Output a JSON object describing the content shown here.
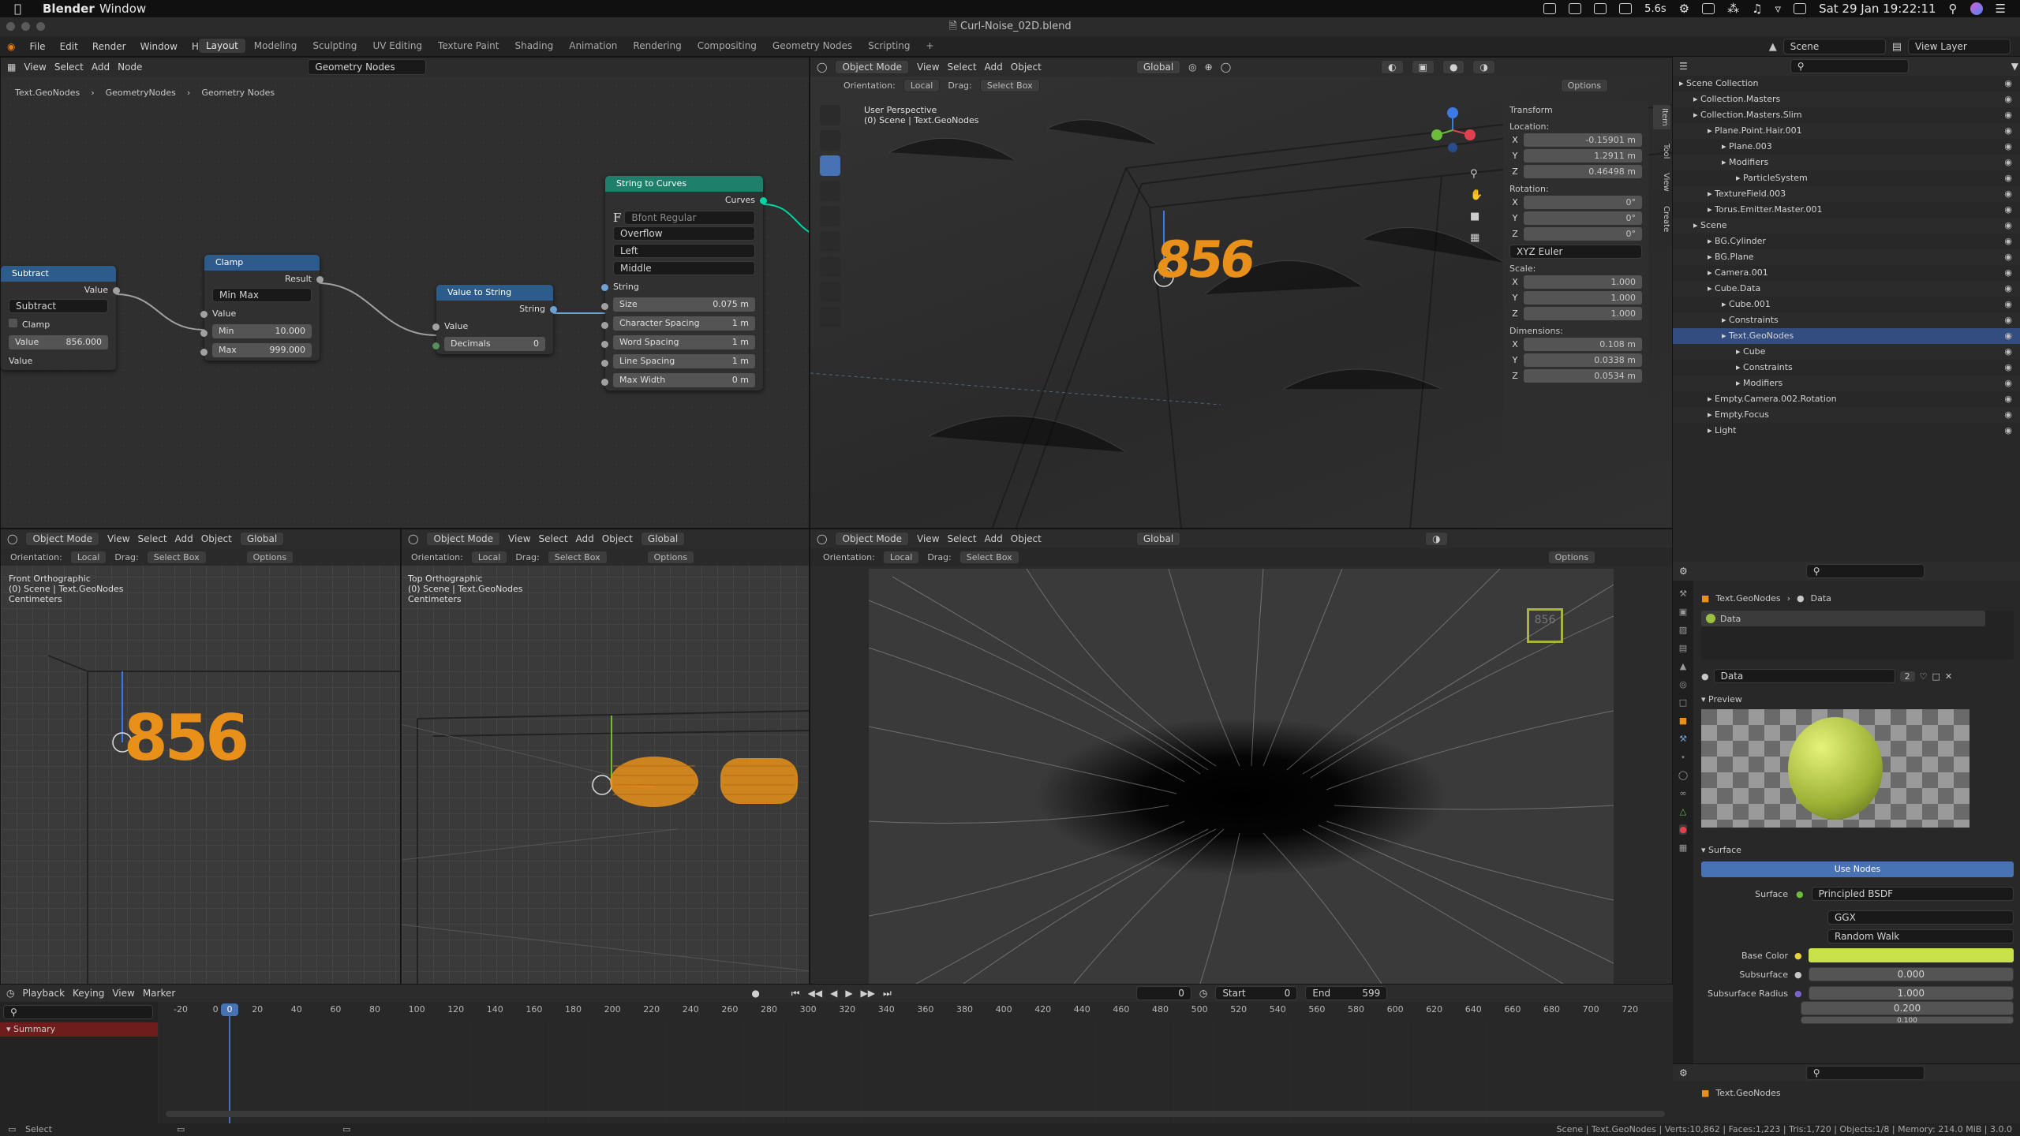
{
  "macbar": {
    "app": "Blender",
    "menu": "Window",
    "battery": "5.6s",
    "datetime": "Sat 29 Jan  19:22:11"
  },
  "window": {
    "title": "Curl-Noise_02D.blend"
  },
  "topmenu": [
    "File",
    "Edit",
    "Render",
    "Window",
    "Help"
  ],
  "workspaces": [
    "Layout",
    "Modeling",
    "Sculpting",
    "UV Editing",
    "Texture Paint",
    "Shading",
    "Animation",
    "Rendering",
    "Compositing",
    "Geometry Nodes",
    "Scripting",
    "+"
  ],
  "scene": "Scene",
  "view_layer": "View Layer",
  "nodeeditor": {
    "menus": [
      "View",
      "Select",
      "Add",
      "Node"
    ],
    "tree": "Geometry Nodes",
    "breadcrumb": [
      "Text.GeoNodes",
      "GeometryNodes",
      "Geometry Nodes"
    ],
    "subtract": {
      "title": "Subtract",
      "op": "Subtract",
      "clamp": "Clamp",
      "value_label": "Value",
      "value": "856.000",
      "out": "Value",
      "in": "Value"
    },
    "clamp": {
      "title": "Clamp",
      "result": "Result",
      "mode": "Min Max",
      "value": "Value",
      "min_label": "Min",
      "min": "10.000",
      "max_label": "Max",
      "max": "999.000"
    },
    "v2s": {
      "title": "Value to String",
      "string": "String",
      "value": "Value",
      "decimals_label": "Decimals",
      "decimals": "0"
    },
    "s2c": {
      "title": "String to Curves",
      "curves": "Curves",
      "font": "Bfont Regular",
      "overflow": "Overflow",
      "align_x": "Left",
      "align_y": "Middle",
      "string": "String",
      "size_label": "Size",
      "size": "0.075 m",
      "cs_label": "Character Spacing",
      "cs": "1 m",
      "ws_label": "Word Spacing",
      "ws": "1 m",
      "ls_label": "Line Spacing",
      "ls": "1 m",
      "mw_label": "Max Width",
      "mw": "0 m"
    }
  },
  "vp_main": {
    "mode": "Object Mode",
    "menus": [
      "View",
      "Select",
      "Add",
      "Object"
    ],
    "transform": "Global",
    "orientation_label": "Orientation:",
    "orientation": "Local",
    "drag_label": "Drag:",
    "drag": "Select Box",
    "options": "Options",
    "title": "User Perspective",
    "subtitle": "(0) Scene | Text.GeoNodes",
    "digits": "856"
  },
  "npanel": {
    "title": "Transform",
    "location": "Location:",
    "loc": [
      "-0.15901 m",
      "1.2911 m",
      "0.46498 m"
    ],
    "rotation": "Rotation:",
    "rot": [
      "0°",
      "0°",
      "0°"
    ],
    "euler": "XYZ Euler",
    "scale": "Scale:",
    "scl": [
      "1.000",
      "1.000",
      "1.000"
    ],
    "dimensions": "Dimensions:",
    "dim": [
      "0.108 m",
      "0.0338 m",
      "0.0534 m"
    ],
    "axes": [
      "X",
      "Y",
      "Z"
    ],
    "tabs": [
      "Item",
      "Tool",
      "View",
      "Create"
    ]
  },
  "outliner": {
    "rows": [
      {
        "t": "Scene Collection",
        "d": 0
      },
      {
        "t": "Collection.Masters",
        "d": 1
      },
      {
        "t": "Collection.Masters.Slim",
        "d": 1
      },
      {
        "t": "Plane.Point.Hair.001",
        "d": 2
      },
      {
        "t": "Plane.003",
        "d": 3
      },
      {
        "t": "Modifiers",
        "d": 3
      },
      {
        "t": "ParticleSystem",
        "d": 4
      },
      {
        "t": "TextureField.003",
        "d": 2
      },
      {
        "t": "Torus.Emitter.Master.001",
        "d": 2
      },
      {
        "t": "Scene",
        "d": 1
      },
      {
        "t": "BG.Cylinder",
        "d": 2
      },
      {
        "t": "BG.Plane",
        "d": 2
      },
      {
        "t": "Camera.001",
        "d": 2
      },
      {
        "t": "Cube.Data",
        "d": 2
      },
      {
        "t": "Cube.001",
        "d": 3
      },
      {
        "t": "Constraints",
        "d": 3
      },
      {
        "t": "Text.GeoNodes",
        "d": 3
      },
      {
        "t": "Cube",
        "d": 4
      },
      {
        "t": "Constraints",
        "d": 4
      },
      {
        "t": "Modifiers",
        "d": 4
      },
      {
        "t": "Empty.Camera.002.Rotation",
        "d": 2
      },
      {
        "t": "Empty.Focus",
        "d": 2
      },
      {
        "t": "Light",
        "d": 2
      }
    ]
  },
  "vp_front": {
    "mode": "Object Mode",
    "menus": [
      "View",
      "Select",
      "Add",
      "Object"
    ],
    "transform": "Global",
    "orientation": "Local",
    "drag": "Select Box",
    "options": "Options",
    "title": "Front Orthographic",
    "subtitle": "(0) Scene | Text.GeoNodes",
    "units": "Centimeters",
    "digits": "856"
  },
  "vp_top": {
    "mode": "Object Mode",
    "menus": [
      "View",
      "Select",
      "Add",
      "Object"
    ],
    "transform": "Global",
    "orientation": "Local",
    "drag": "Select Box",
    "options": "Options",
    "title": "Top Orthographic",
    "subtitle": "(0) Scene | Text.GeoNodes",
    "units": "Centimeters"
  },
  "vp_cam": {
    "mode": "Object Mode",
    "menus": [
      "View",
      "Select",
      "Add",
      "Object"
    ],
    "transform": "Global",
    "orientation": "Local",
    "drag": "Select Box",
    "options": "Options",
    "digits": "856"
  },
  "properties": {
    "obj": "Text.GeoNodes",
    "data": "Data",
    "slot": "Data",
    "slot_users": "2",
    "preview": "Preview",
    "surface_panel": "Surface",
    "use_nodes": "Use Nodes",
    "surface_label": "Surface",
    "surface_val": "Principled BSDF",
    "dist": "GGX",
    "sss": "Random Walk",
    "base_color": "Base Color",
    "subsurface": "Subsurface",
    "subsurface_val": "0.000",
    "ss_radius": "Subsurface Radius",
    "ss_r": [
      "1.000",
      "0.200",
      "0.100"
    ],
    "lower_obj": "Text.GeoNodes"
  },
  "timeline": {
    "menus": [
      "Playback",
      "Keying",
      "View",
      "Marker"
    ],
    "frame": "0",
    "start_label": "Start",
    "start": "0",
    "end_label": "End",
    "end": "599",
    "summary": "Summary",
    "ticks": [
      "-20",
      "0",
      "20",
      "40",
      "60",
      "80",
      "100",
      "120",
      "140",
      "160",
      "180",
      "200",
      "220",
      "240",
      "260",
      "280",
      "300",
      "320",
      "340",
      "360",
      "380",
      "400",
      "420",
      "440",
      "460",
      "480",
      "500",
      "520",
      "540",
      "560",
      "580",
      "600",
      "620",
      "640",
      "660",
      "680",
      "700",
      "720"
    ],
    "current": "0"
  },
  "status": {
    "left": "Select",
    "right": "Scene | Text.GeoNodes | Verts:10,862 | Faces:1,223 | Tris:1,720 | Objects:1/8 | Memory: 214.0 MiB | 3.0.0"
  },
  "colors": {
    "accent": "#4772b3",
    "node_vector": "#2d5c8c",
    "node_func": "#3c8b78",
    "socket_string": "#6ea1d6",
    "socket_geo": "#00d6a3",
    "object_orange": "#e8901a",
    "base_color": "#c9e24b"
  }
}
